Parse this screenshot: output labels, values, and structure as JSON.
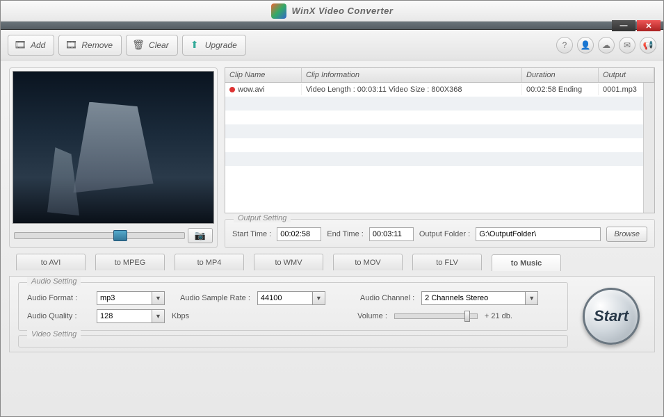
{
  "app": {
    "title": "WinX Video Converter"
  },
  "toolbar": {
    "add": "Add",
    "remove": "Remove",
    "clear": "Clear",
    "upgrade": "Upgrade"
  },
  "grid": {
    "headers": {
      "name": "Clip Name",
      "info": "Clip Information",
      "duration": "Duration",
      "output": "Output"
    },
    "rows": [
      {
        "name": "wow.avi",
        "info": "Video Length : 00:03:11 Video Size : 800X368",
        "duration": "00:02:58  Ending",
        "output": "0001.mp3"
      }
    ]
  },
  "output": {
    "legend": "Output Setting",
    "start_label": "Start Time :",
    "start_value": "00:02:58",
    "end_label": "End Time :",
    "end_value": "00:03:11",
    "folder_label": "Output Folder :",
    "folder_value": "G:\\OutputFolder\\",
    "browse": "Browse"
  },
  "tabs": {
    "items": [
      "to AVI",
      "to MPEG",
      "to MP4",
      "to WMV",
      "to MOV",
      "to FLV",
      "to Music"
    ],
    "active": 6
  },
  "audio": {
    "legend": "Audio Setting",
    "format_label": "Audio Format :",
    "format_value": "mp3",
    "sample_label": "Audio Sample Rate :",
    "sample_value": "44100",
    "channel_label": "Audio Channel :",
    "channel_value": "2 Channels Stereo",
    "quality_label": "Audio Quality :",
    "quality_value": "128",
    "quality_unit": "Kbps",
    "volume_label": "Volume :",
    "volume_text": "+ 21 db."
  },
  "video": {
    "legend": "Video Setting"
  },
  "start": {
    "label": "Start"
  }
}
